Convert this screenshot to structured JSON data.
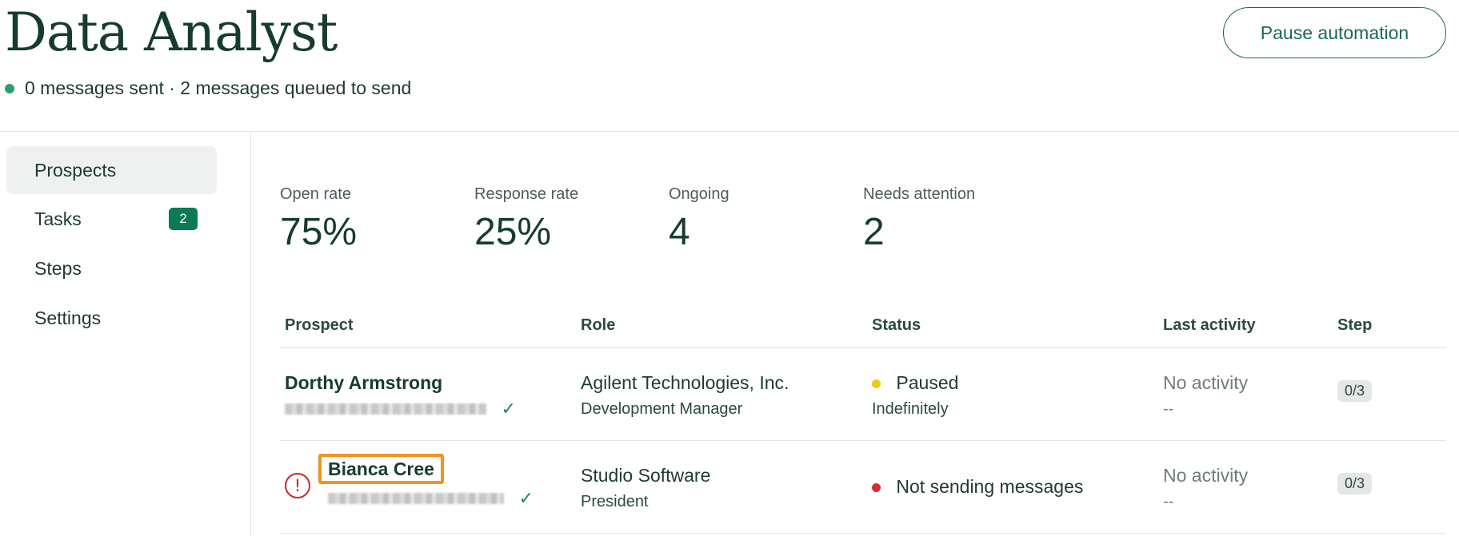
{
  "header": {
    "title": "Data Analyst",
    "subtitle": "0 messages sent · 2 messages queued to send",
    "pause_button_label": "Pause automation"
  },
  "sidebar": {
    "items": [
      {
        "label": "Prospects",
        "active": true
      },
      {
        "label": "Tasks",
        "badge": "2"
      },
      {
        "label": "Steps"
      },
      {
        "label": "Settings"
      }
    ]
  },
  "stats": [
    {
      "label": "Open rate",
      "value": "75%"
    },
    {
      "label": "Response rate",
      "value": "25%"
    },
    {
      "label": "Ongoing",
      "value": "4"
    },
    {
      "label": "Needs attention",
      "value": "2"
    }
  ],
  "table": {
    "columns": [
      "Prospect",
      "Role",
      "Status",
      "Last activity",
      "Step"
    ],
    "rows": [
      {
        "name": "Dorthy Armstrong",
        "email_hidden": true,
        "company": "Agilent Technologies, Inc.",
        "role": "Development Manager",
        "status": "Paused",
        "status_sub": "Indefinitely",
        "status_color": "#f2c811",
        "last_activity": "No activity",
        "last_activity_sub": "--",
        "step": "0/3",
        "warning": false
      },
      {
        "name": "Bianca Cree",
        "email_hidden": true,
        "company": "Studio Software",
        "role": "President",
        "status": "Not sending messages",
        "status_sub": "",
        "status_color": "#d32f2f",
        "last_activity": "No activity",
        "last_activity_sub": "--",
        "step": "0/3",
        "warning": true
      }
    ]
  },
  "icons": {
    "check": "✓",
    "warning": "!"
  }
}
